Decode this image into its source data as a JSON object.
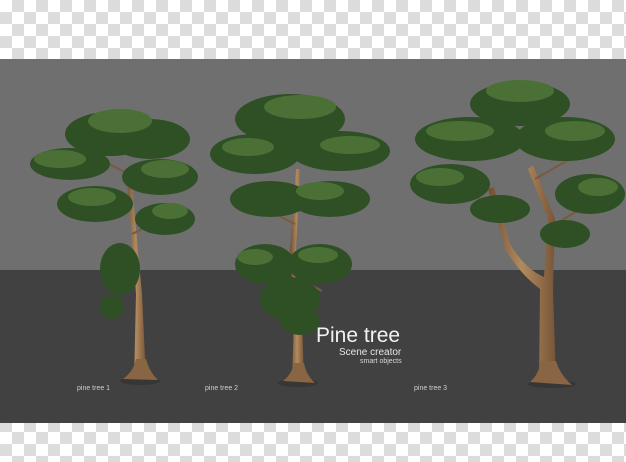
{
  "title": "Pine tree",
  "subtitle": "Scene creator",
  "subsubtitle": "smart objects",
  "tree_labels": [
    "pine tree 1",
    "pine tree 2",
    "pine tree 3"
  ],
  "colors": {
    "wall": "#6f6f6f",
    "floor": "#414141",
    "foliage_dark": "#2c4a22",
    "foliage_mid": "#3e6330",
    "foliage_light": "#5a7f45",
    "trunk": "#a0774f"
  }
}
